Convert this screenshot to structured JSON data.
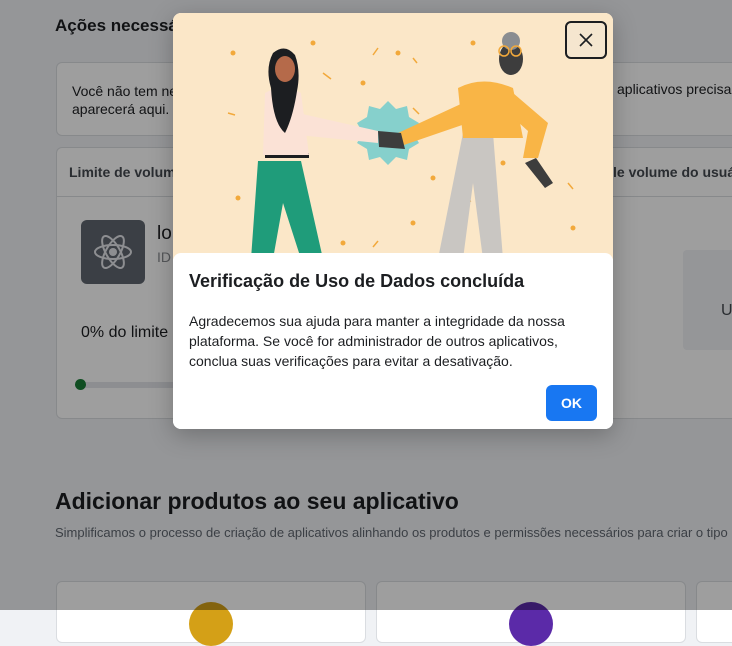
{
  "background": {
    "actions_title": "Ações necessá",
    "notice": {
      "text_start": "Você não tem ne",
      "text_line2": "aparecerá aqui.",
      "text_end": "aplicativos precisa"
    },
    "limits": {
      "header_left": "Limite de volume",
      "header_right": "le volume do usuári",
      "app_name": "lo",
      "app_id": "ID",
      "usage_label": "0% do limite",
      "progress_value": 0,
      "side_box_text": "U"
    },
    "add_products": {
      "title": "Adicionar produtos ao seu aplicativo",
      "subtitle": "Simplificamos o processo de criação de aplicativos alinhando os produtos e permissões necessários para criar o tipo"
    }
  },
  "modal": {
    "title": "Verificação de Uso de Dados concluída",
    "body": "Agradecemos sua ajuda para manter a integridade da nossa plataforma. Se você for administrador de outros aplicativos, conclua suas verificações para evitar a desativação.",
    "ok_label": "OK",
    "close_icon": "close-icon",
    "illustration": "handshake-illustration"
  },
  "colors": {
    "primary": "#1877f2",
    "progress": "#1a7f37",
    "illustration_bg": "#fbe7c8"
  }
}
